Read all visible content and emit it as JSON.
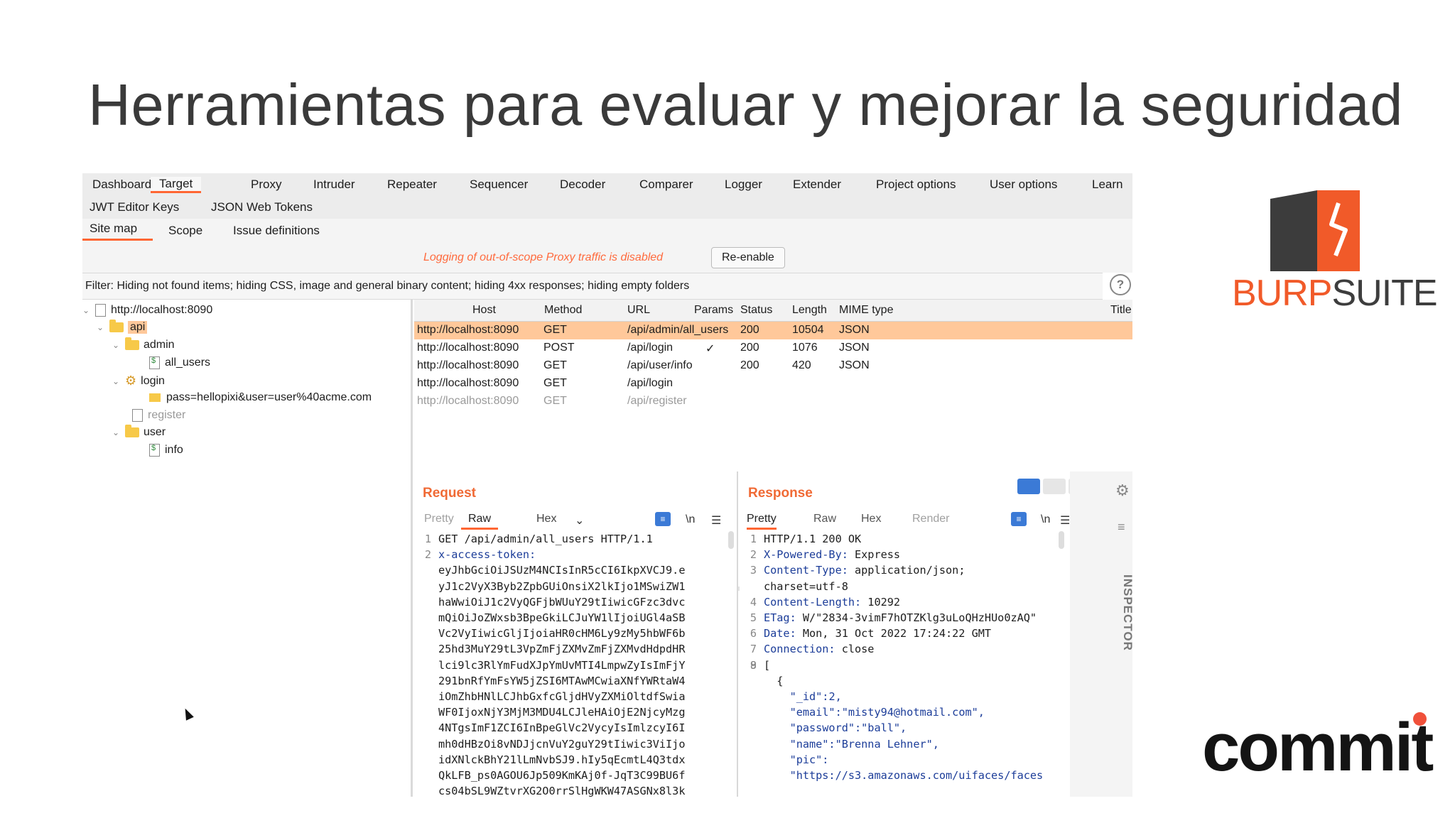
{
  "slide": {
    "title": "Herramientas para evaluar y mejorar la seguridad"
  },
  "tabs_main": [
    "Dashboard",
    "Target",
    "Proxy",
    "Intruder",
    "Repeater",
    "Sequencer",
    "Decoder",
    "Comparer",
    "Logger",
    "Extender",
    "Project options",
    "User options",
    "Learn"
  ],
  "tabs_ext": [
    "JWT Editor Keys",
    "JSON Web Tokens"
  ],
  "tabs_target": [
    "Site map",
    "Scope",
    "Issue definitions"
  ],
  "notice": {
    "message": "Logging of out-of-scope Proxy traffic is disabled",
    "button": "Re-enable"
  },
  "filter": {
    "text": "Filter: Hiding not found items;  hiding CSS, image and general binary content;  hiding 4xx responses;  hiding empty folders",
    "help": "?"
  },
  "tree": {
    "root": "http://localhost:8090",
    "api": "api",
    "admin": "admin",
    "all_users": "all_users",
    "login": "login",
    "login_param": "pass=hellopixi&user=user%40acme.com",
    "register": "register",
    "user": "user",
    "info": "info"
  },
  "table": {
    "columns": [
      "Host",
      "Method",
      "URL",
      "Params",
      "Status",
      "Length",
      "MIME type",
      "Title"
    ],
    "rows": [
      {
        "host": "http://localhost:8090",
        "method": "GET",
        "url": "/api/admin/all_users",
        "params": "",
        "status": "200",
        "length": "10504",
        "mime": "JSON"
      },
      {
        "host": "http://localhost:8090",
        "method": "POST",
        "url": "/api/login",
        "params": "✓",
        "status": "200",
        "length": "1076",
        "mime": "JSON"
      },
      {
        "host": "http://localhost:8090",
        "method": "GET",
        "url": "/api/user/info",
        "params": "",
        "status": "200",
        "length": "420",
        "mime": "JSON"
      },
      {
        "host": "http://localhost:8090",
        "method": "GET",
        "url": "/api/login",
        "params": "",
        "status": "",
        "length": "",
        "mime": ""
      },
      {
        "host": "http://localhost:8090",
        "method": "GET",
        "url": "/api/register",
        "params": "",
        "status": "",
        "length": "",
        "mime": ""
      }
    ]
  },
  "request": {
    "title": "Request",
    "tabs": [
      "Pretty",
      "Raw",
      "Hex"
    ],
    "newline_label": "\\n",
    "lines": [
      {
        "n": "1",
        "text": "GET /api/admin/all_users HTTP/1.1"
      },
      {
        "n": "2",
        "text": "x-access-token:"
      },
      {
        "n": "",
        "text": "eyJhbGciOiJSUzM4NCIsInR5cCI6IkpXVCJ9.e"
      },
      {
        "n": "",
        "text": "yJ1c2VyX3Byb2ZpbGUiOnsiX2lkIjo1MSwiZW1"
      },
      {
        "n": "",
        "text": "haWwiOiJ1c2VyQGFjbWUuY29tIiwicGFzc3dvc"
      },
      {
        "n": "",
        "text": "mQiOiJoZWxsb3BpeGkiLCJuYW1lIjoiUGl4aSB"
      },
      {
        "n": "",
        "text": "Vc2VyIiwicGljIjoiaHR0cHM6Ly9zMy5hbWF6b"
      },
      {
        "n": "",
        "text": "25hd3MuY29tL3VpZmFjZXMvZmFjZXMvdHdpdHR"
      },
      {
        "n": "",
        "text": "lci9lc3RlYmFudXJpYmUvMTI4LmpwZyIsImFjY"
      },
      {
        "n": "",
        "text": "291bnRfYmFsYW5jZSI6MTAwMCwiaXNfYWRtaW4"
      },
      {
        "n": "",
        "text": "iOmZhbHNlLCJhbGxfcGljdHVyZXMiOltdfSwia"
      },
      {
        "n": "",
        "text": "WF0IjoxNjY3MjM3MDU4LCJleHAiOjE2NjcyMzg"
      },
      {
        "n": "",
        "text": "4NTgsImF1ZCI6InBpeGlVc2VycyIsImlzcyI6I"
      },
      {
        "n": "",
        "text": "mh0dHBzOi8vNDJjcnVuY2guY29tIiwic3ViIjo"
      },
      {
        "n": "",
        "text": "idXNlckBhY21lLmNvbSJ9.hIy5qEcmtL4Q3tdx"
      },
      {
        "n": "",
        "text": "QkLFB_ps0AGOU6Jp509KmKAj0f-JqT3C99BU6f"
      },
      {
        "n": "",
        "text": "cs04bSL9WZtvrXG2O0rrSlHgWKW47ASGNx8l3k"
      }
    ]
  },
  "response": {
    "title": "Response",
    "tabs": [
      "Pretty",
      "Raw",
      "Hex",
      "Render"
    ],
    "newline_label": "\\n",
    "lines": [
      {
        "n": "1",
        "k": "",
        "v": "HTTP/1.1 200 OK"
      },
      {
        "n": "2",
        "k": "X-Powered-By:",
        "v": " Express"
      },
      {
        "n": "3",
        "k": "Content-Type:",
        "v": " application/json;"
      },
      {
        "n": "",
        "k": "",
        "v": "charset=utf-8"
      },
      {
        "n": "4",
        "k": "Content-Length:",
        "v": " 10292"
      },
      {
        "n": "5",
        "k": "ETag:",
        "v": " W/\"2834-3vimF7hOTZKlg3uLoQHzHUo0zAQ\""
      },
      {
        "n": "6",
        "k": "Date:",
        "v": " Mon, 31 Oct 2022 17:24:22 GMT"
      },
      {
        "n": "7",
        "k": "Connection:",
        "v": " close"
      },
      {
        "n": "8",
        "k": "",
        "v": ""
      },
      {
        "n": "9",
        "k": "",
        "v": "["
      },
      {
        "n": "",
        "k": "",
        "v": "  {"
      },
      {
        "n": "",
        "k": "    \"_id\":",
        "v": "2,"
      },
      {
        "n": "",
        "k": "    \"email\":",
        "v": "\"misty94@hotmail.com\","
      },
      {
        "n": "",
        "k": "    \"password\":",
        "v": "\"ball\","
      },
      {
        "n": "",
        "k": "    \"name\":",
        "v": "\"Brenna Lehner\","
      },
      {
        "n": "",
        "k": "    \"pic\":",
        "v": ""
      },
      {
        "n": "",
        "k": "    \"https://s3.amazonaws.com/uifaces/faces",
        "v": ""
      }
    ]
  },
  "inspector": "INSPECTOR",
  "logos": {
    "burp_a": "BURP",
    "burp_b": "SUITE",
    "commit": "commit"
  },
  "colors": {
    "accent": "#ff6633",
    "burp_orange": "#f15a29",
    "selected_row": "#ffc89a",
    "commit_dot": "#f0503a"
  }
}
